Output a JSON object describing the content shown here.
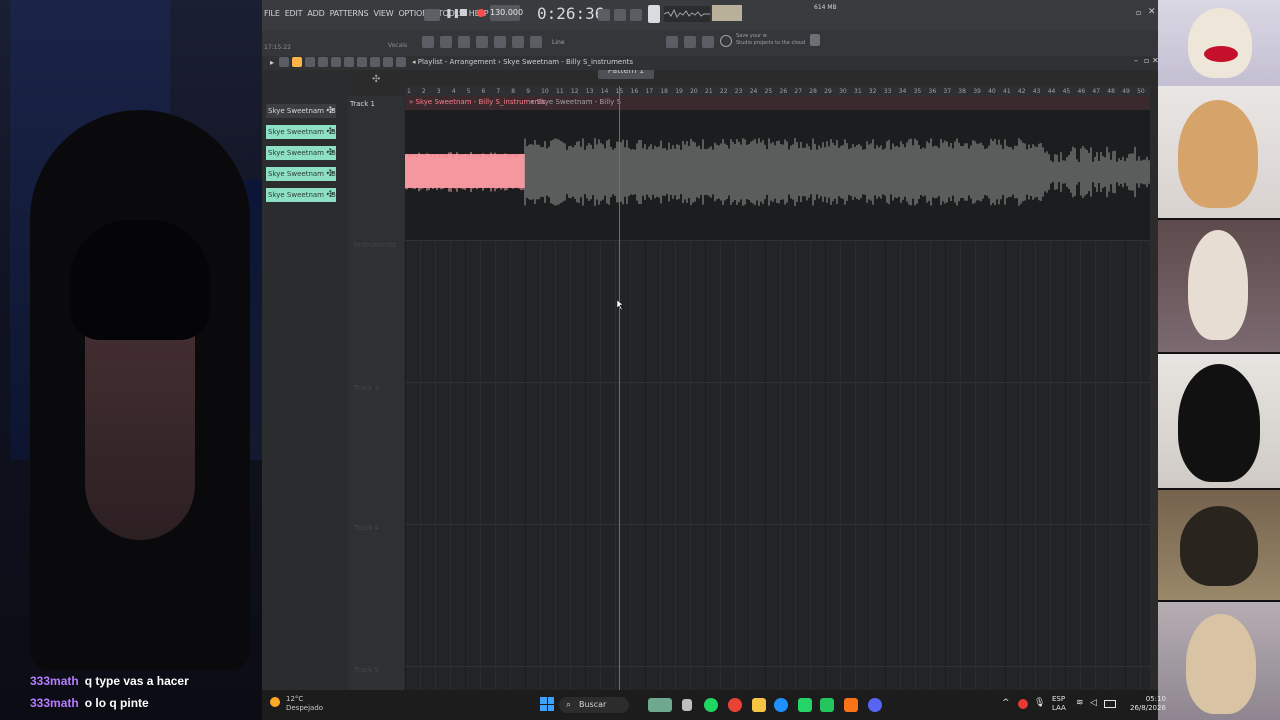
{
  "menu": [
    "FILE",
    "EDIT",
    "ADD",
    "PATTERNS",
    "VIEW",
    "OPTIONS",
    "TOOLS",
    "HELP"
  ],
  "transport": {
    "tempo": "130.000",
    "time": "0:26:36",
    "cpu": "614 MB"
  },
  "toolbar": {
    "vocals_label": "Vocals",
    "info_time": "17:15:22",
    "pattern_label": "Pattern 1",
    "line_label": "Line",
    "save_tip_1": "Save your w",
    "save_tip_2": "Studio projects to the cloud"
  },
  "playlist": {
    "title": "Playlist - Arrangement",
    "breadcrumb": "Skye Sweetnam - Billy S_instruments"
  },
  "track_panel": {
    "items": [
      "Skye Sweetnam - Bil...",
      "Skye Sweetnam - Bil...",
      "Skye Sweetnam - Bil...",
      "Skye Sweetnam - Bil...",
      "Skye Sweetnam - Bil...",
      "Skye Sweetnam - Bil..."
    ]
  },
  "tracks": {
    "track1": "Track 1",
    "track2": "Instruments",
    "track3": "Track 3",
    "track4": "Track 4",
    "track5": "Track 5"
  },
  "ruler": [
    "1",
    "2",
    "3",
    "4",
    "5",
    "6",
    "7",
    "8",
    "9",
    "10",
    "11",
    "12",
    "13",
    "14",
    "15",
    "16",
    "17",
    "18",
    "19",
    "20",
    "21",
    "22",
    "23",
    "24",
    "25",
    "26",
    "27",
    "28",
    "29",
    "30",
    "31",
    "32",
    "33",
    "34",
    "35",
    "36",
    "37",
    "38",
    "39",
    "40",
    "41",
    "42",
    "43",
    "44",
    "45",
    "46",
    "47",
    "48",
    "49",
    "50"
  ],
  "clip": {
    "title_active": "Skye Sweetnam - Billy S_instruments",
    "title_rest": "Skye Sweetnam - Billy S"
  },
  "chat": [
    {
      "user": "333math",
      "msg": "q type vas a hacer"
    },
    {
      "user": "333math",
      "msg": "o lo q pinte"
    }
  ],
  "taskbar": {
    "search_placeholder": "Buscar",
    "weather_temp": "12°C",
    "weather_desc": "Despejado",
    "lang_1": "ESP",
    "lang_2": "LAA",
    "time": "05:10",
    "date": "26/8/2026"
  },
  "colors": {
    "accent_clip": "#f28b94",
    "track_item": "#8ee0c4",
    "chat_user": "#b77bff"
  }
}
